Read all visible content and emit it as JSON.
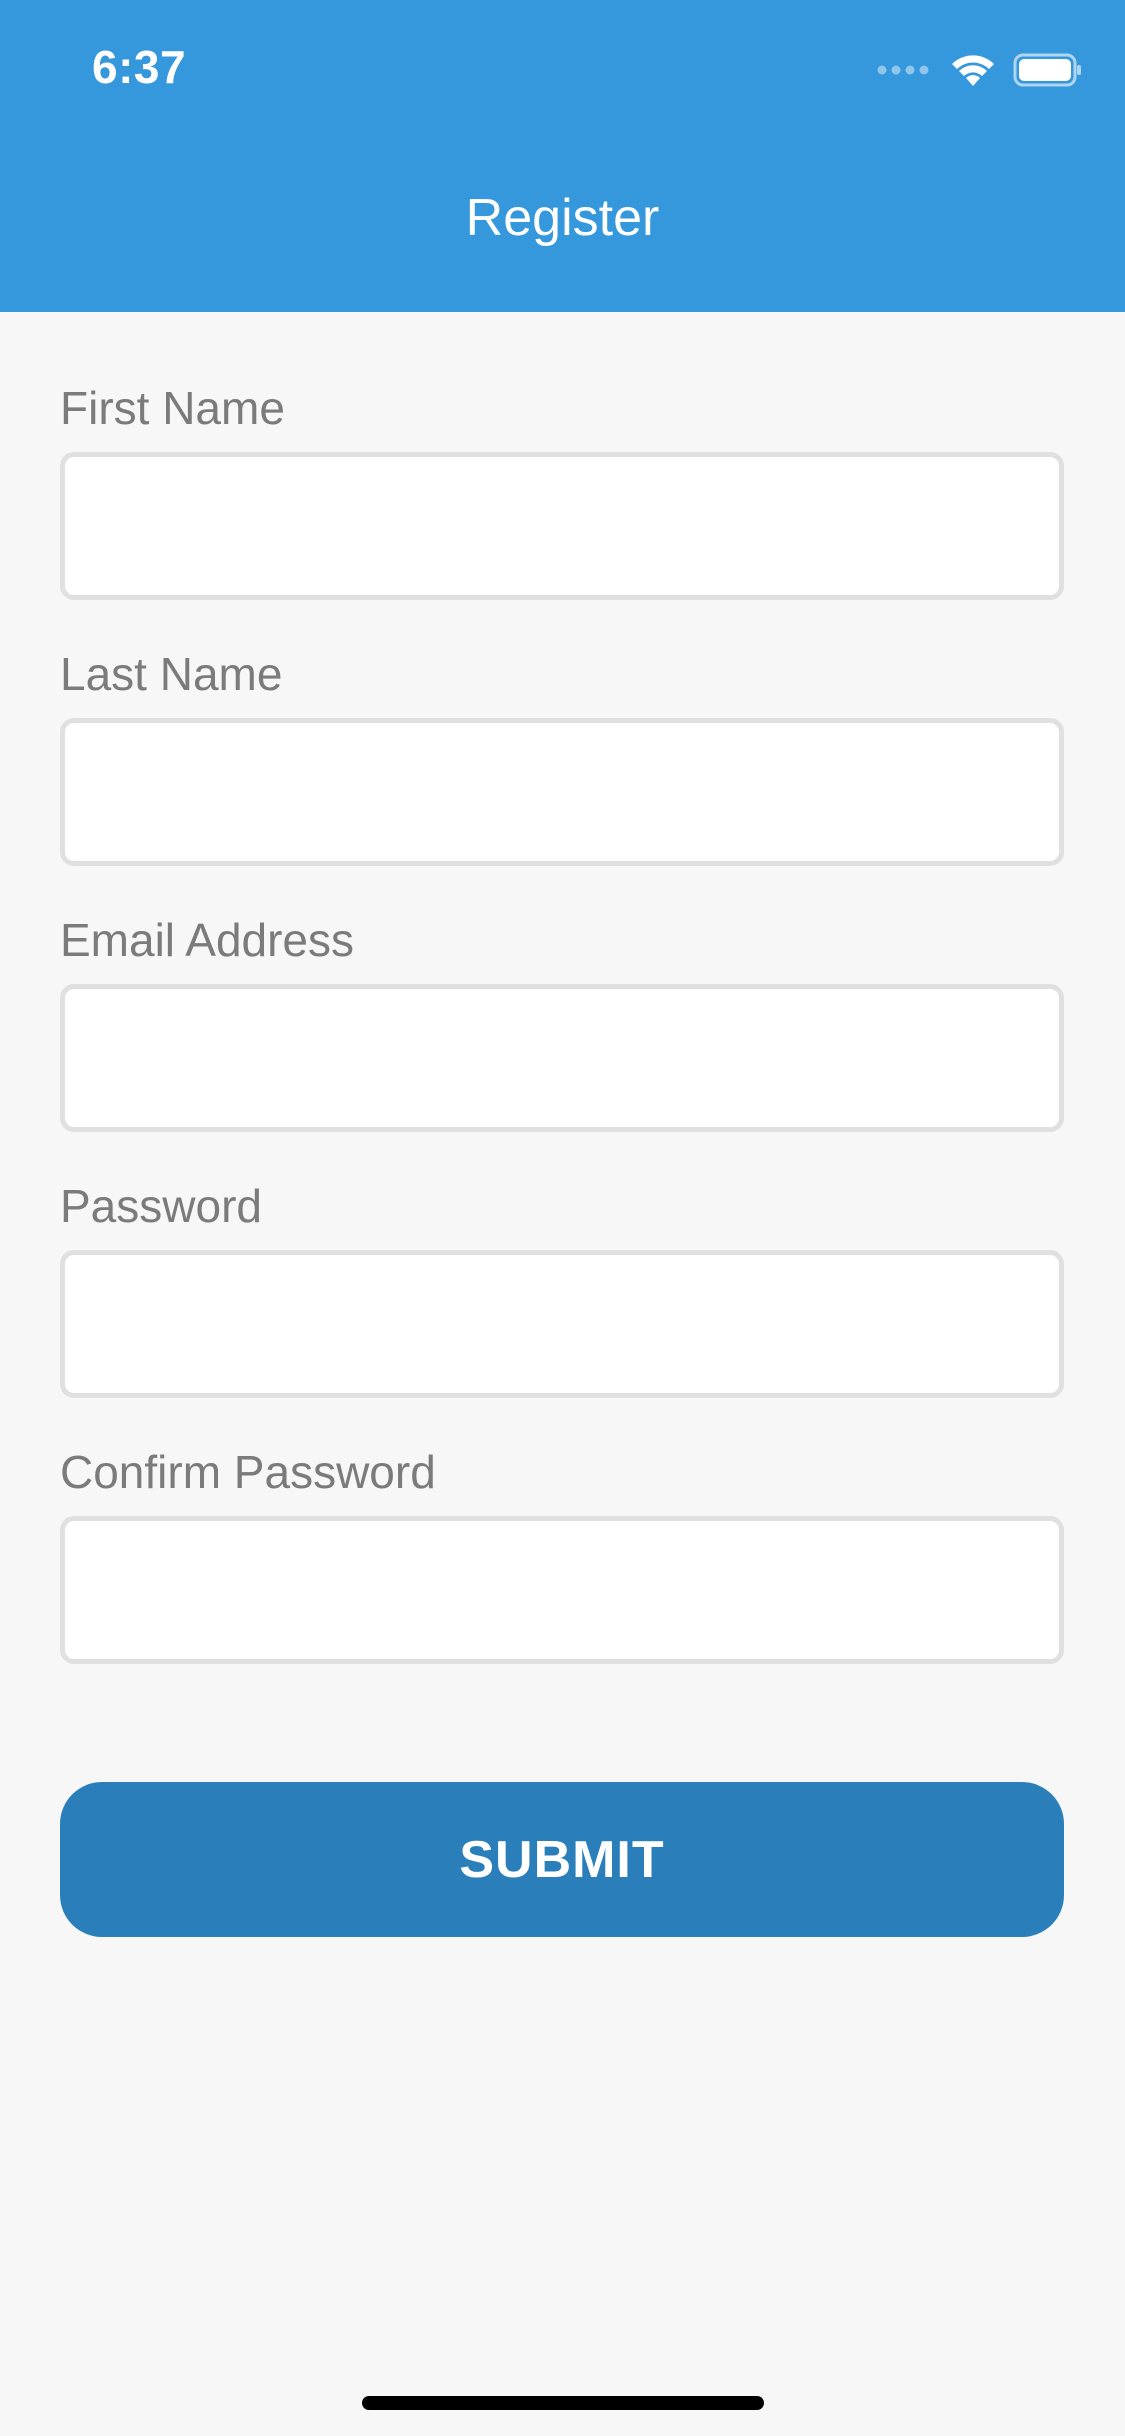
{
  "status_bar": {
    "time": "6:37",
    "icons": [
      "signal-icon",
      "wifi-icon",
      "battery-icon"
    ]
  },
  "header": {
    "title": "Register"
  },
  "form": {
    "fields": [
      {
        "label": "First Name",
        "value": "",
        "placeholder": ""
      },
      {
        "label": "Last Name",
        "value": "",
        "placeholder": ""
      },
      {
        "label": "Email Address",
        "value": "",
        "placeholder": ""
      },
      {
        "label": "Password",
        "value": "",
        "placeholder": ""
      },
      {
        "label": "Confirm Password",
        "value": "",
        "placeholder": ""
      }
    ],
    "submit_label": "SUBMIT"
  },
  "colors": {
    "header_background": "#3597dc",
    "submit_background": "#2a7fba",
    "page_background": "#f7f7f7",
    "label_text": "#7b7b7b",
    "input_border": "#e0e0e0"
  }
}
